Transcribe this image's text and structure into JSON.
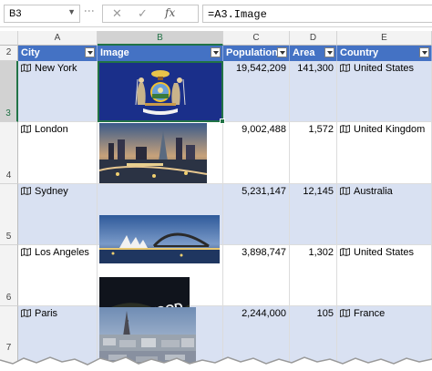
{
  "formula_bar": {
    "name_box": "B3",
    "formula": "=A3.Image",
    "cancel_icon": "✕",
    "enter_icon": "✓",
    "fx_label": "fx"
  },
  "columns": [
    "A",
    "B",
    "C",
    "D",
    "E"
  ],
  "header_row_number": "2",
  "table": {
    "headers": [
      "City",
      "Image",
      "Population",
      "Area",
      "Country"
    ],
    "rows": [
      {
        "row_number": "3",
        "city": "New York",
        "population": "19,542,209",
        "area": "141,300",
        "country": "United States",
        "image_desc": "flag"
      },
      {
        "row_number": "4",
        "city": "London",
        "population": "9,002,488",
        "area": "1,572",
        "country": "United Kingdom",
        "image_desc": "skyline"
      },
      {
        "row_number": "5",
        "city": "Sydney",
        "population": "5,231,147",
        "area": "12,145",
        "country": "Australia",
        "image_desc": "harbour"
      },
      {
        "row_number": "6",
        "city": "Los Angeles",
        "population": "3,898,747",
        "area": "1,302",
        "country": "United States",
        "image_desc": "hollywood"
      },
      {
        "row_number": "7",
        "city": "Paris",
        "population": "2,244,000",
        "area": "105",
        "country": "France",
        "image_desc": "paris"
      }
    ]
  },
  "hollywood_sign": "HOLLYWOOD",
  "colors": {
    "header_blue": "#4472c4",
    "band_blue": "#d9e1f2",
    "selection_green": "#217346",
    "flag_blue": "#1a2f8a"
  },
  "icons": [
    "map-icon",
    "filter-dropdown-icon",
    "cancel-icon",
    "enter-icon",
    "function-icon"
  ]
}
